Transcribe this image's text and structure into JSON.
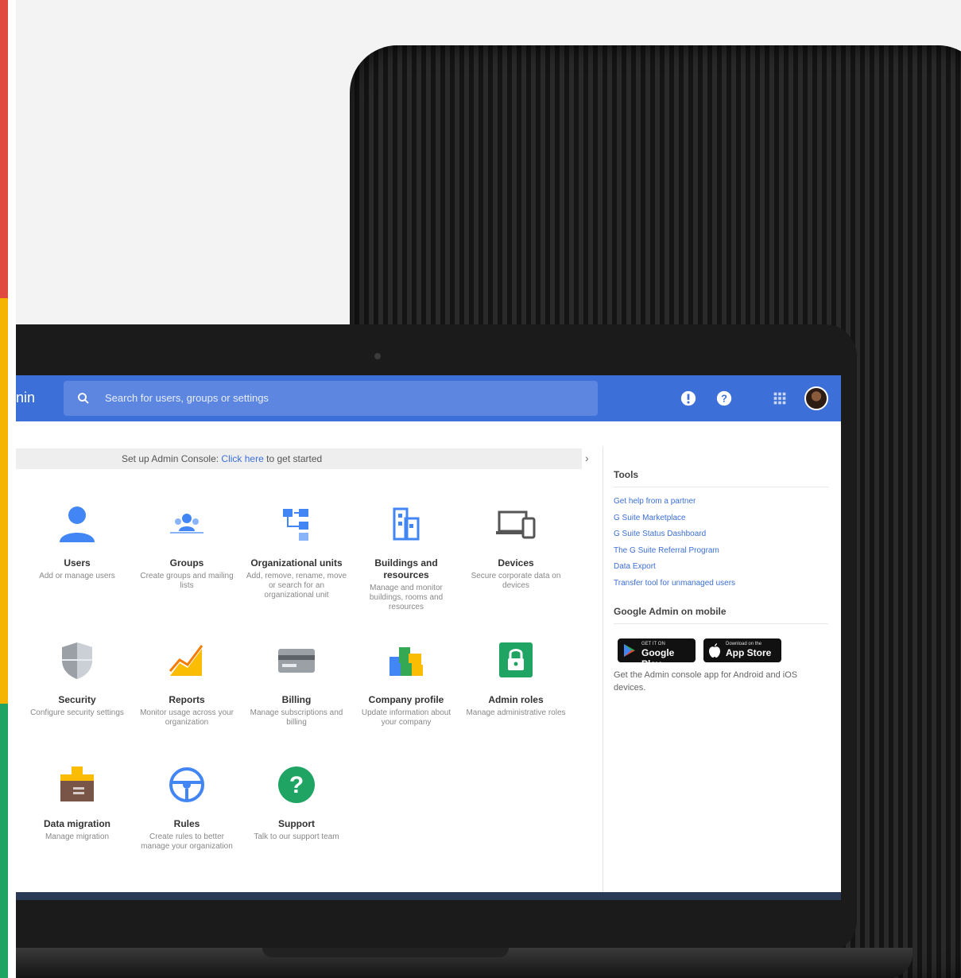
{
  "colors": {
    "accent": "#3c6fd8",
    "stripe": [
      "#e04a3f",
      "#f4b400",
      "#1fa463"
    ]
  },
  "topbar": {
    "brand": "nin",
    "search_placeholder": "Search for users, groups or settings",
    "icons": [
      "search-icon",
      "notifications-icon",
      "help-icon",
      "apps-grid-icon",
      "account-avatar"
    ]
  },
  "notice": {
    "prefix": "Set up Admin Console:",
    "link": "Click here",
    "suffix": "to get started"
  },
  "tiles": [
    {
      "title": "Users",
      "desc": "Add or manage users",
      "icon": "user-icon"
    },
    {
      "title": "Groups",
      "desc": "Create groups and mailing lists",
      "icon": "groups-icon"
    },
    {
      "title": "Organizational units",
      "desc": "Add, remove, rename, move or search for an organizational unit",
      "icon": "org-units-icon"
    },
    {
      "title": "Buildings and resources",
      "desc": "Manage and monitor buildings, rooms and resources",
      "icon": "buildings-icon"
    },
    {
      "title": "Devices",
      "desc": "Secure corporate data on devices",
      "icon": "devices-icon"
    },
    {
      "title": "Security",
      "desc": "Configure security settings",
      "icon": "shield-icon"
    },
    {
      "title": "Reports",
      "desc": "Monitor usage across your organization",
      "icon": "reports-icon"
    },
    {
      "title": "Billing",
      "desc": "Manage subscriptions and billing",
      "icon": "billing-card-icon"
    },
    {
      "title": "Company profile",
      "desc": "Update information about your company",
      "icon": "company-profile-icon"
    },
    {
      "title": "Admin roles",
      "desc": "Manage administrative roles",
      "icon": "lock-icon"
    },
    {
      "title": "Data migration",
      "desc": "Manage migration",
      "icon": "data-migration-icon"
    },
    {
      "title": "Rules",
      "desc": "Create rules to better manage your organization",
      "icon": "steering-wheel-icon"
    },
    {
      "title": "Support",
      "desc": "Talk to our support team",
      "icon": "support-question-icon"
    }
  ],
  "panel": {
    "tools_heading": "Tools",
    "tools_links": [
      "Get help from a partner",
      "G Suite Marketplace",
      "G Suite Status Dashboard",
      "The G Suite Referral Program",
      "Data Export",
      "Transfer tool for unmanaged users"
    ],
    "mobile_heading": "Google Admin on mobile",
    "google_play_small": "GET IT ON",
    "google_play": "Google Play",
    "app_store_small": "Download on the",
    "app_store": "App Store",
    "mobile_note": "Get the Admin console app for Android and iOS devices."
  }
}
